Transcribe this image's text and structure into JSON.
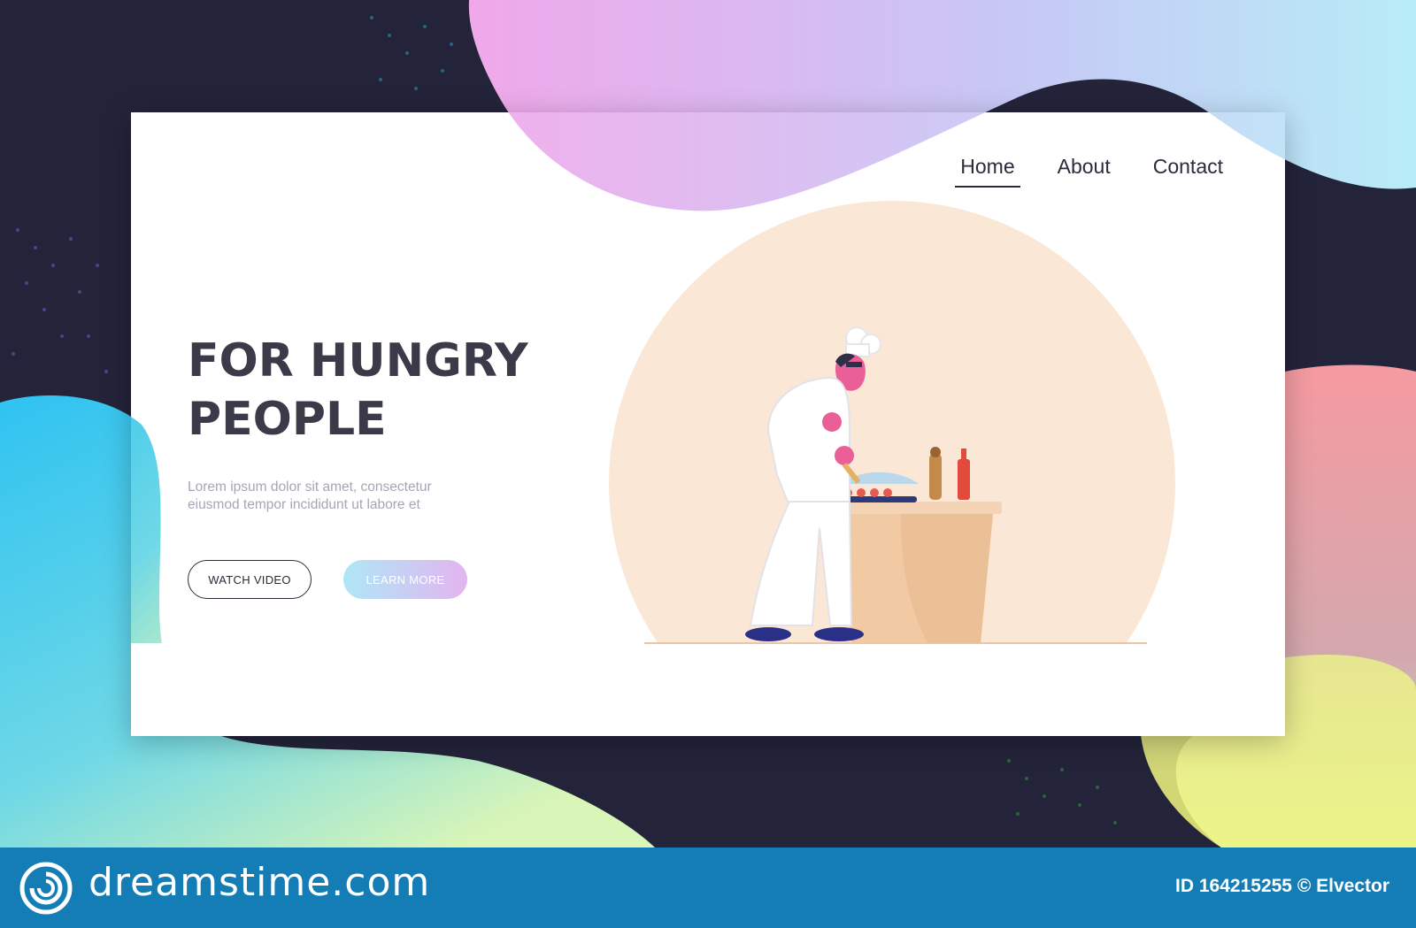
{
  "nav": {
    "items": [
      {
        "label": "Home",
        "active": true
      },
      {
        "label": "About",
        "active": false
      },
      {
        "label": "Contact",
        "active": false
      }
    ]
  },
  "hero": {
    "title_line1": "FOR HUNGRY",
    "title_line2": "PEOPLE",
    "text_line1": "Lorem ipsum dolor sit amet, consectetur",
    "text_line2": "eiusmod tempor incididunt ut labore et",
    "watch_video_label": "WATCH VIDEO",
    "learn_more_label": "LEARN MORE"
  },
  "illustration": {
    "subject": "chef seasoning dish at counter",
    "icons": [
      "chef-figure-icon",
      "counter-icon",
      "pepper-mill-icon",
      "ketchup-bottle-icon",
      "plate-icon"
    ]
  },
  "footer": {
    "brand": "dreamstime.com",
    "stock_id": "ID 164215255 © Elvector",
    "logo_icon": "dreamstime-spiral-icon"
  },
  "colors": {
    "background_dark": "#23233a",
    "accent_pink": "#e9b4ef",
    "accent_blue": "#2fc3f1",
    "accent_coral": "#f08f93",
    "accent_yellow": "#e8f07a",
    "footer_blue": "#157db6",
    "title": "#3a3a48",
    "body_text": "#a6a6b4",
    "circle_beige": "#fbe7d6"
  }
}
